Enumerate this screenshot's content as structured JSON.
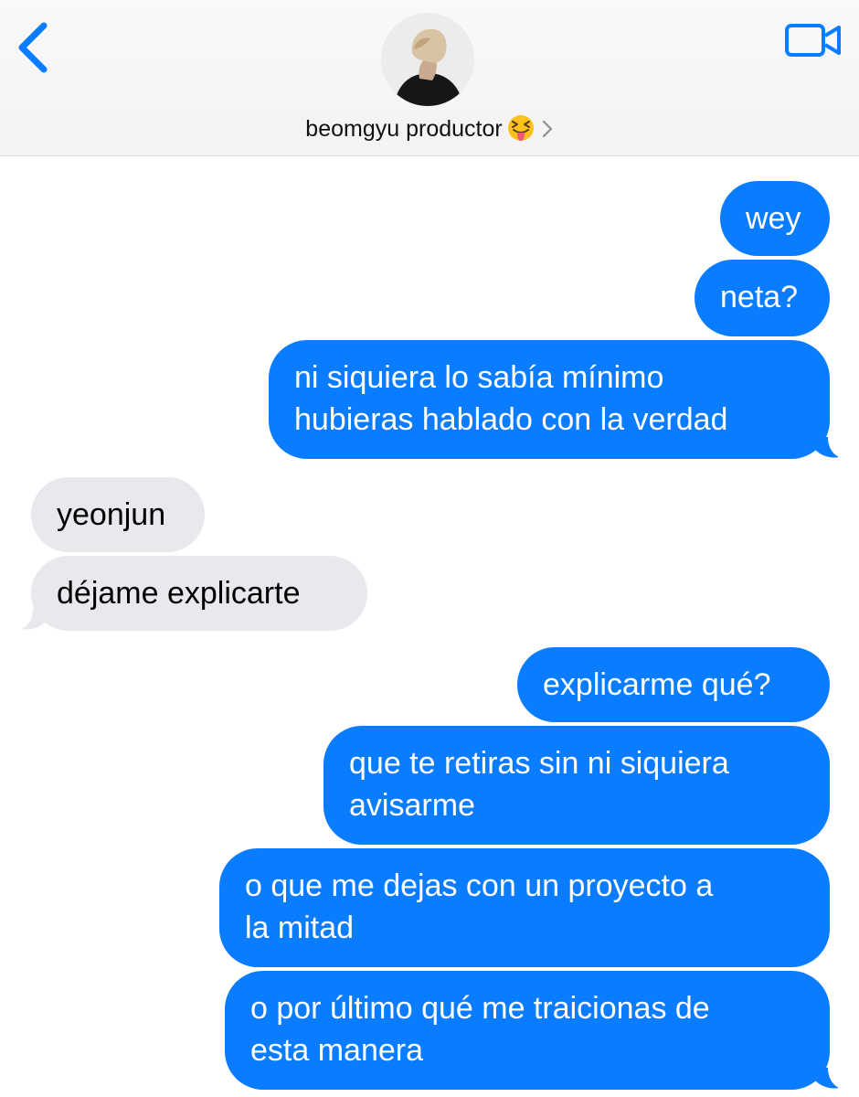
{
  "header": {
    "contact_name": "beomgyu productor",
    "contact_emoji": "squinting-face-with-tongue-emoji",
    "back_icon": "chevron-left-icon",
    "video_icon": "video-camera-icon",
    "disclosure_icon": "chevron-right-icon"
  },
  "messages": [
    {
      "direction": "outgoing",
      "lines": [
        "wey"
      ]
    },
    {
      "direction": "outgoing",
      "lines": [
        "neta?"
      ]
    },
    {
      "direction": "outgoing",
      "lines": [
        "ni siquiera lo sabía mínimo",
        "hubieras hablado con la verdad"
      ]
    },
    {
      "direction": "incoming",
      "lines": [
        "yeonjun"
      ]
    },
    {
      "direction": "incoming",
      "lines": [
        "déjame explicarte"
      ]
    },
    {
      "direction": "outgoing",
      "lines": [
        "explicarme qué?"
      ]
    },
    {
      "direction": "outgoing",
      "lines": [
        "que te retiras sin ni siquiera",
        "avisarme"
      ]
    },
    {
      "direction": "outgoing",
      "lines": [
        "o que me dejas con un proyecto a",
        "la mitad"
      ]
    },
    {
      "direction": "outgoing",
      "lines": [
        "o por último qué me traicionas de",
        "esta manera"
      ]
    }
  ],
  "colors": {
    "outgoing_bubble": "#0a7cff",
    "incoming_bubble": "#e8e8ed",
    "accent": "#0a7cff"
  }
}
